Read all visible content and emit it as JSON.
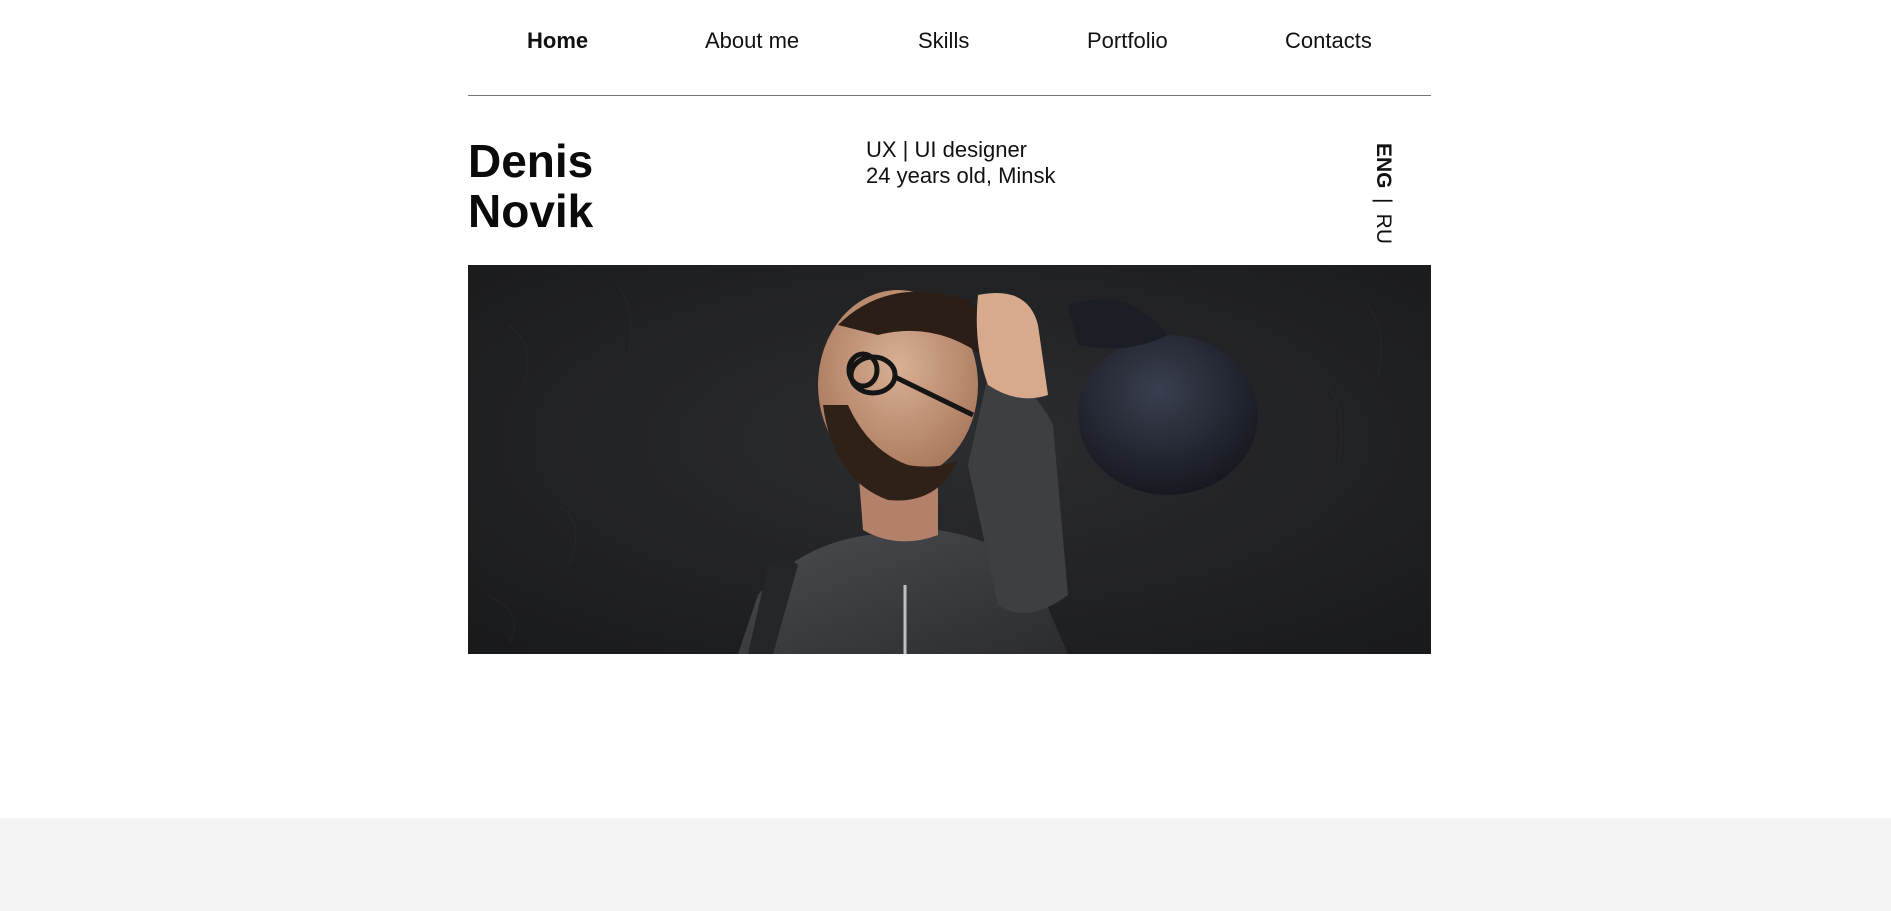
{
  "nav": {
    "items": [
      {
        "label": "Home",
        "active": true
      },
      {
        "label": "About me",
        "active": false
      },
      {
        "label": "Skills",
        "active": false
      },
      {
        "label": "Portfolio",
        "active": false
      },
      {
        "label": "Contacts",
        "active": false
      }
    ]
  },
  "hero": {
    "name_first": "Denis",
    "name_last": "Novik",
    "role": "UX | UI designer",
    "details": "24 years old, Minsk"
  },
  "language": {
    "current": "ENG",
    "separator": "|",
    "other": "RU"
  },
  "colors": {
    "text": "#111111",
    "divider": "#777777",
    "photo_background": "#1f2022",
    "footer_band": "#f3f3f3"
  }
}
